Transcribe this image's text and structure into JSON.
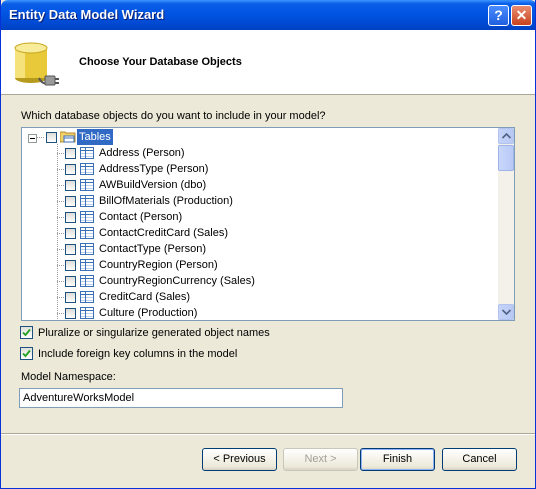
{
  "window": {
    "title": "Entity Data Model Wizard",
    "help_glyph": "?",
    "close_glyph": "✕"
  },
  "header": {
    "title": "Choose Your Database Objects"
  },
  "prompt": "Which database objects do you want to include in your model?",
  "tree": {
    "root_label": "Tables",
    "items": [
      "Address (Person)",
      "AddressType (Person)",
      "AWBuildVersion (dbo)",
      "BillOfMaterials (Production)",
      "Contact (Person)",
      "ContactCreditCard (Sales)",
      "ContactType (Person)",
      "CountryRegion (Person)",
      "CountryRegionCurrency (Sales)",
      "CreditCard (Sales)",
      "Culture (Production)"
    ]
  },
  "options": {
    "pluralize_label": "Pluralize or singularize generated object names",
    "pluralize_checked": true,
    "foreign_keys_label": "Include foreign key columns in the model",
    "foreign_keys_checked": true
  },
  "namespace": {
    "label": "Model Namespace:",
    "value": "AdventureWorksModel"
  },
  "buttons": {
    "previous": "< Previous",
    "next": "Next >",
    "finish": "Finish",
    "cancel": "Cancel"
  },
  "colors": {
    "titlebar": "#0054e3",
    "selection": "#316ac5",
    "dialog_bg": "#ece9d8"
  }
}
